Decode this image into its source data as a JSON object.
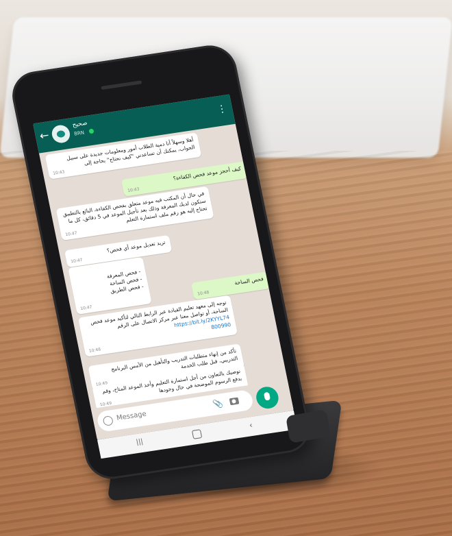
{
  "chat_header": {
    "contact_name": "صحيح",
    "status": "BRN"
  },
  "messages": [
    {
      "dir": "in",
      "text": "أهلا وسهلاً أنا دمية الطلاب أمور ومعلومات جديدة على سبيل الجواب، يمكنك أن تساعدني \"كيف نحتاج\" بحاجة إلى",
      "time": "10:43"
    },
    {
      "dir": "out",
      "text": "كيف أحجز موعد فحص الكفاءة؟",
      "time": "10:43"
    },
    {
      "dir": "in",
      "text": "في حال أن المكتب فيه موعد متعلق بفحص الكفاءة، البائع بالتطبيق ستكون لديك المعرفة وذلك بعد تأجيل الموعد في 5 دقائق، كل ما تحتاج إليه هو رقم ملف استمارة التعلم",
      "time": "10:47"
    },
    {
      "dir": "in",
      "text": "تريد تعديل موعد أي فحص؟",
      "time": "10:47"
    },
    {
      "dir": "in",
      "text": "- فحص المعرفة\n- فحص الساحة\n- فحص الطريق",
      "time": "10:47"
    },
    {
      "dir": "out",
      "text": "فحص الساحة",
      "time": "10:48"
    },
    {
      "dir": "in",
      "text": "توجه إلى معهد تعليم القيادة عبر الرابط التالي لتأكيد موعد فحص الساحة، أو تواصل معنا عبر مركز الاتصال على الرقم",
      "link": "https://bit.ly/2KYYL74",
      "number": "800990",
      "time": "10:48"
    },
    {
      "dir": "in",
      "text": "تأكد من إنهاء متطلبات التدريب والتأهيل من الأمس البرنامج التدريبي، قبل طلب الخدمة",
      "time": "10:49"
    },
    {
      "dir": "in",
      "text": "نوصيك بالتعاون من أجل استمارة التعليم وأخذ الموعد المتاح، وقم بدفع الرسوم الموضحة في حال وجودها",
      "time": "10:49"
    }
  ],
  "composer": {
    "placeholder": "Message"
  },
  "icons": {
    "back": "back-arrow-icon",
    "more": "more-vert-icon",
    "emoji": "emoji-icon",
    "attach": "attach-icon",
    "camera": "camera-icon",
    "mic": "mic-icon"
  },
  "colors": {
    "header": "#075e54",
    "outgoing_bubble": "#dcf8c6",
    "incoming_bubble": "#ffffff",
    "chat_background": "#e5ddd5",
    "mic_button": "#00a884"
  }
}
